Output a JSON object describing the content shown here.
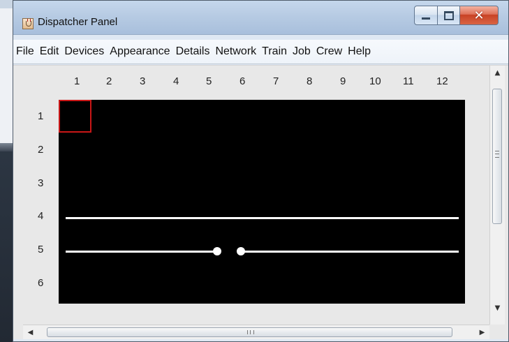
{
  "window": {
    "title": "Dispatcher Panel"
  },
  "menus": [
    {
      "label": "File"
    },
    {
      "label": "Edit"
    },
    {
      "label": "Devices"
    },
    {
      "label": "Appearance"
    },
    {
      "label": "Details"
    },
    {
      "label": "Network"
    },
    {
      "label": "Train"
    },
    {
      "label": "Job"
    },
    {
      "label": "Crew"
    },
    {
      "label": "Help"
    }
  ],
  "grid": {
    "columns": [
      "1",
      "2",
      "3",
      "4",
      "5",
      "6",
      "7",
      "8",
      "9",
      "10",
      "11",
      "12"
    ],
    "rows": [
      "1",
      "2",
      "3",
      "4",
      "5",
      "6"
    ]
  },
  "icons": {
    "app": "java-app-icon",
    "minimize": "minimize-icon",
    "maximize": "maximize-icon",
    "close": "close-icon",
    "scroll_up": "chevron-up-icon",
    "scroll_down": "chevron-down-icon",
    "scroll_left": "chevron-left-icon",
    "scroll_right": "chevron-right-icon"
  },
  "colors": {
    "canvas_background": "#000000",
    "track": "#ffffff",
    "selection_border": "#c91717"
  }
}
